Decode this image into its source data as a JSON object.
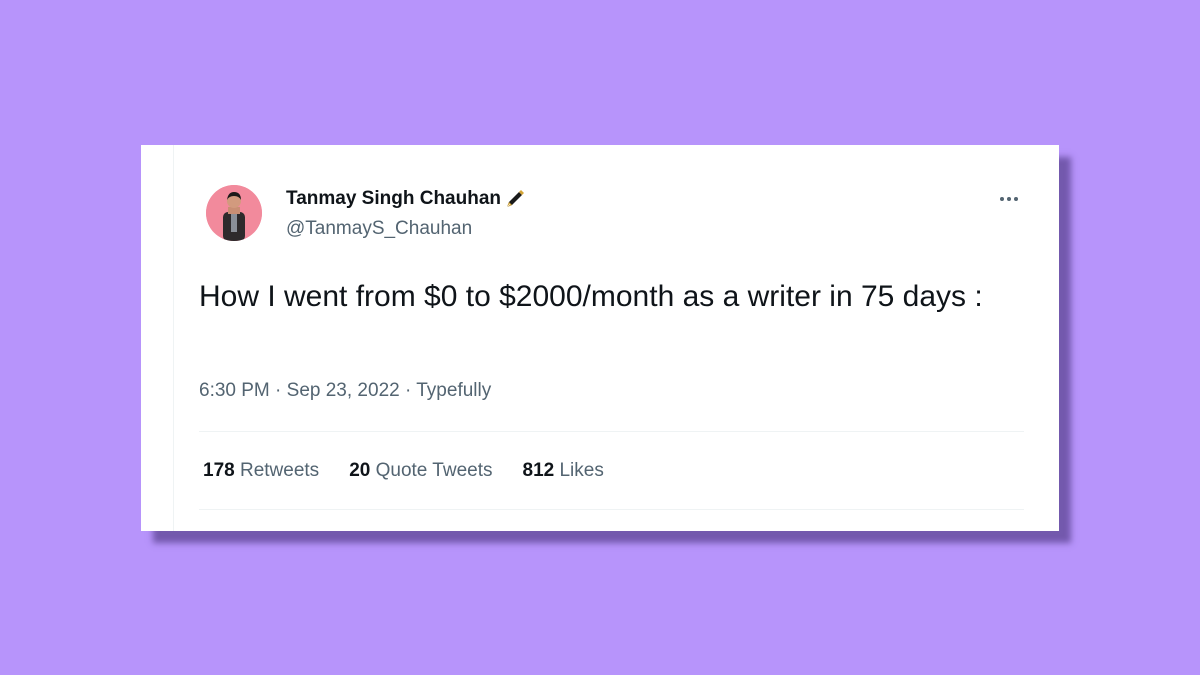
{
  "colors": {
    "background": "#b794fb",
    "card": "#ffffff",
    "text_primary": "#0f1419",
    "text_secondary": "#536471"
  },
  "tweet": {
    "author": {
      "display_name": "Tanmay Singh Chauhan",
      "badge_icon": "fountain-pen-icon",
      "handle": "@TanmayS_Chauhan"
    },
    "more_icon": "more-horizontal-icon",
    "text": "How I went from $0 to $2000/month as a writer in 75 days :",
    "time": "6:30 PM",
    "separator": "·",
    "date": "Sep 23, 2022",
    "source": "Typefully",
    "stats": {
      "retweets_count": "178",
      "retweets_label": "Retweets",
      "quotes_count": "20",
      "quotes_label": "Quote Tweets",
      "likes_count": "812",
      "likes_label": "Likes"
    }
  }
}
